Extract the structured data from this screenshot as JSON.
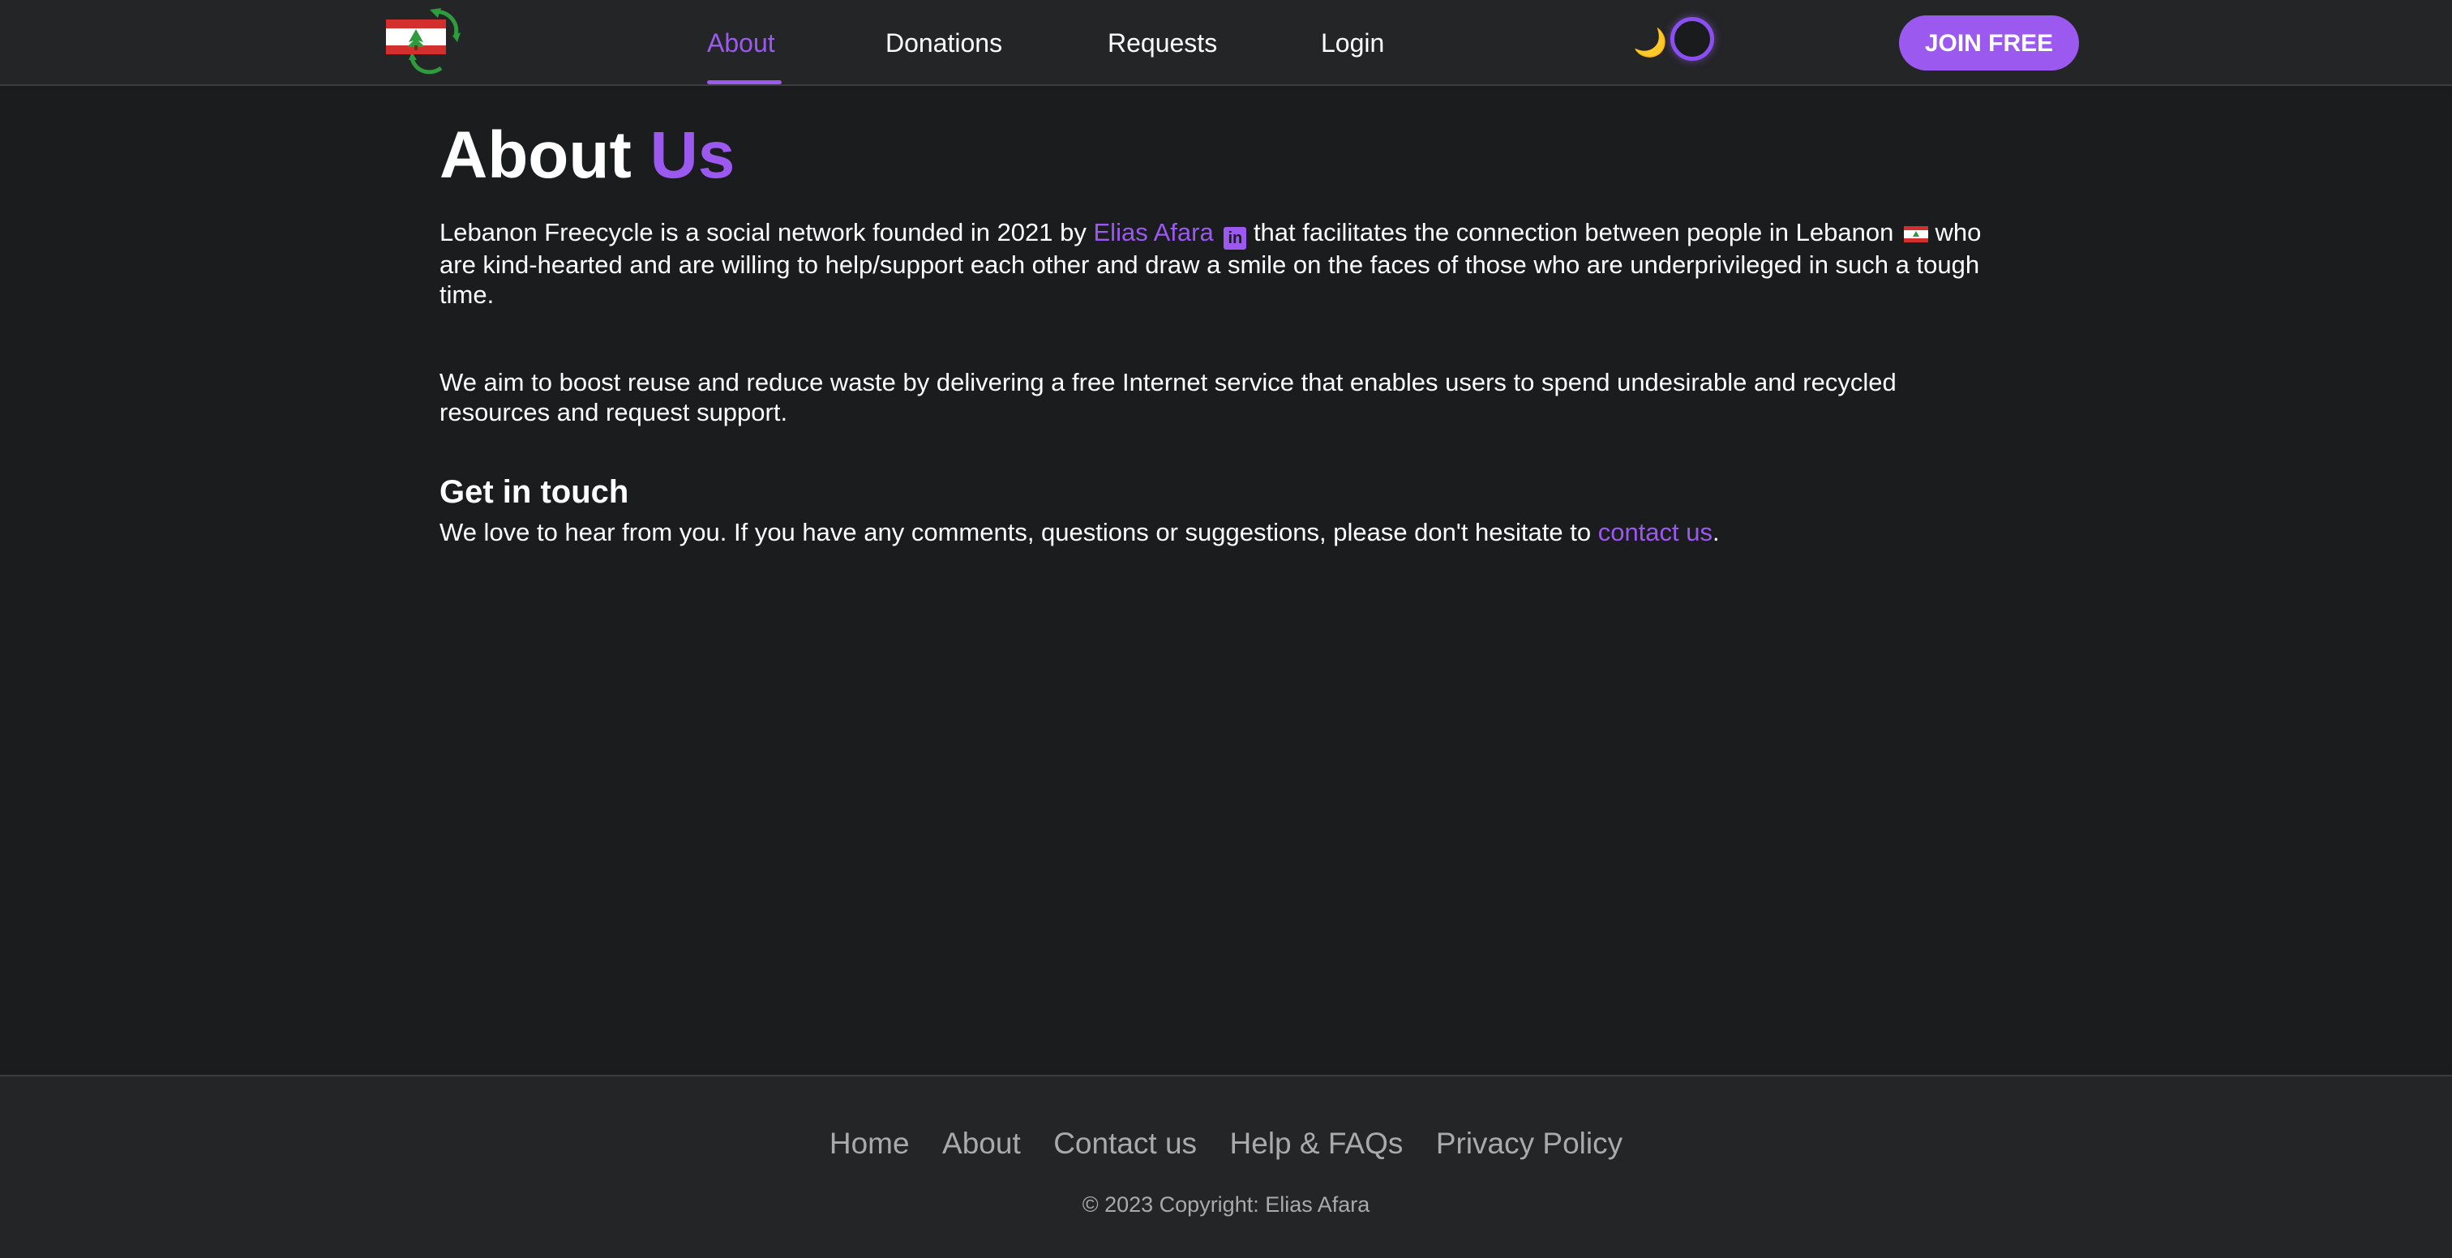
{
  "header": {
    "logo_alt": "Lebanon Freecycle logo",
    "nav": [
      {
        "label": "About",
        "active": true
      },
      {
        "label": "Donations",
        "active": false
      },
      {
        "label": "Requests",
        "active": false
      },
      {
        "label": "Login",
        "active": false
      }
    ],
    "theme_toggle": {
      "icon": "moon-icon",
      "mode": "dark"
    },
    "join_label": "JOIN FREE"
  },
  "main": {
    "title_part1": "About",
    "title_part2": "Us",
    "intro_before": "Lebanon Freecycle is a social network founded in 2021 by ",
    "founder_name": "Elias Afara",
    "linkedin_label": "in",
    "intro_after": " that facilitates the connection between people in Lebanon ",
    "intro_end": " who are kind-hearted and are willing to help/support each other and draw a smile on the faces of those who are underprivileged in such a tough time.",
    "mission": "We aim to boost reuse and reduce waste by delivering a free Internet service that enables users to spend undesirable and recycled resources and request support.",
    "contact_heading": "Get in touch",
    "contact_before": "We love to hear from you. If you have any comments, questions or suggestions, please don't hesitate to ",
    "contact_link": "contact us",
    "contact_after": "."
  },
  "footer": {
    "links": [
      "Home",
      "About",
      "Contact us",
      "Help & FAQs",
      "Privacy Policy"
    ],
    "copyright": "© 2023 Copyright: Elias Afara"
  },
  "colors": {
    "accent": "#9b59f0",
    "background": "#1b1c1e",
    "surface": "#242527",
    "flag_red": "#d32f2f",
    "cedar_green": "#2e9b3c"
  }
}
